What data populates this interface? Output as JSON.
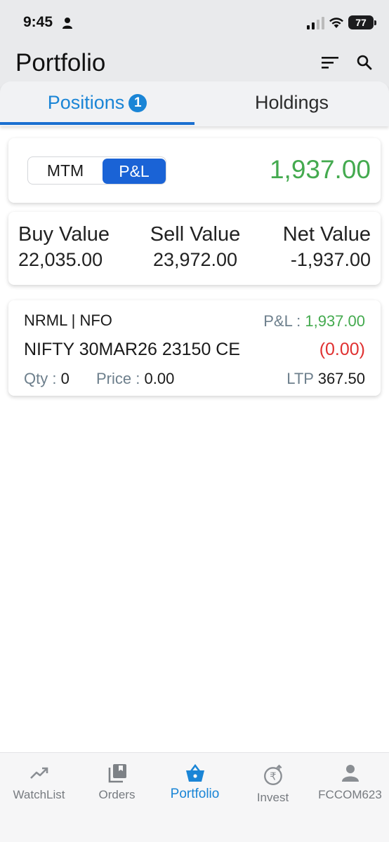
{
  "status_bar": {
    "time": "9:45",
    "battery": "77"
  },
  "header": {
    "title": "Portfolio"
  },
  "tabs": [
    {
      "label": "Positions",
      "badge": "1"
    },
    {
      "label": "Holdings"
    }
  ],
  "summary": {
    "toggle": {
      "mtm_label": "MTM",
      "pl_label": "P&L",
      "selected": "P&L"
    },
    "value": "1,937.00"
  },
  "values": {
    "buy_label": "Buy Value",
    "buy_value": "22,035.00",
    "sell_label": "Sell Value",
    "sell_value": "23,972.00",
    "net_label": "Net Value",
    "net_value": "-1,937.00"
  },
  "position": {
    "product_type": "NRML | NFO",
    "pl_label": "P&L :",
    "pl_value": "1,937.00",
    "symbol": "NIFTY 30MAR26 23150 CE",
    "change": "(0.00)",
    "qty_label": "Qty :",
    "qty_value": "0",
    "price_label": "Price :",
    "price_value": "0.00",
    "ltp_label": "LTP",
    "ltp_value": "367.50"
  },
  "bottom_nav": [
    {
      "label": "WatchList",
      "icon": "trend-up-icon"
    },
    {
      "label": "Orders",
      "icon": "orders-book-icon"
    },
    {
      "label": "Portfolio",
      "icon": "basket-icon",
      "active": true
    },
    {
      "label": "Invest",
      "icon": "rupee-invest-icon"
    },
    {
      "label": "FCCOM623",
      "icon": "person-icon"
    }
  ],
  "colors": {
    "accent": "#1a85d6",
    "profit": "#44aa4f",
    "loss": "#e03131",
    "toggle_active": "#1a63d6"
  }
}
